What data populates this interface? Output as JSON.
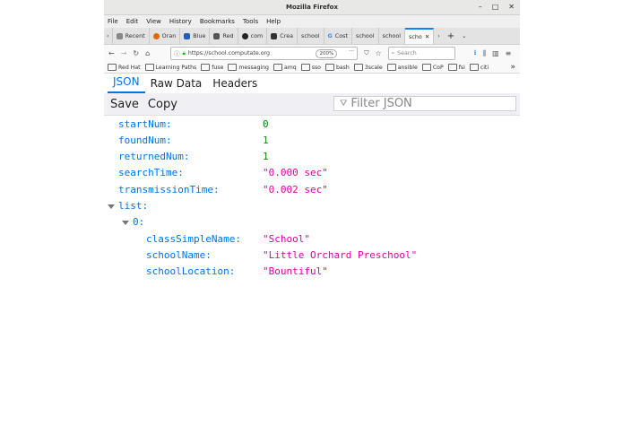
{
  "window": {
    "title": "Mozilla Firefox",
    "controls": [
      "–",
      "□",
      "✕"
    ]
  },
  "menu": [
    "File",
    "Edit",
    "View",
    "History",
    "Bookmarks",
    "Tools",
    "Help"
  ],
  "tabs": [
    {
      "label": "Recent",
      "icon": "page-icon",
      "color": "#888888"
    },
    {
      "label": "Oran",
      "icon": "orange-icon",
      "color": "#e06c00"
    },
    {
      "label": "Blue",
      "icon": "bl-icon",
      "color": "#1f5fbf"
    },
    {
      "label": "Red",
      "icon": "red-icon",
      "color": "#555555"
    },
    {
      "label": "com",
      "icon": "github-icon",
      "color": "#222222"
    },
    {
      "label": "Crea",
      "icon": "app-icon",
      "color": "#333333"
    },
    {
      "label": "school",
      "icon": "page-icon",
      "color": "#aaaaaa"
    },
    {
      "label": "Cost",
      "icon": "google-icon",
      "color": "#4285f4"
    },
    {
      "label": "school",
      "icon": "page-icon",
      "color": "#aaaaaa"
    },
    {
      "label": "school",
      "icon": "page-icon",
      "color": "#aaaaaa"
    },
    {
      "label": "scho",
      "icon": "page-icon",
      "color": "#aaaaaa",
      "active": true
    }
  ],
  "nav": {
    "url": "https://school.computate.org",
    "zoom": "200%",
    "search_placeholder": "Search"
  },
  "bookmarks": [
    "Red Hat",
    "Learning Paths",
    "fuse",
    "messaging",
    "amq",
    "sso",
    "bash",
    "3scale",
    "ansible",
    "CoP",
    "fsi",
    "citi"
  ],
  "viewer": {
    "tabs": [
      "JSON",
      "Raw Data",
      "Headers"
    ],
    "save_label": "Save",
    "copy_label": "Copy",
    "filter_placeholder": "Filter JSON"
  },
  "json": {
    "startNum": {
      "key": "startNum:",
      "value": "0"
    },
    "foundNum": {
      "key": "foundNum:",
      "value": "1"
    },
    "returnedNum": {
      "key": "returnedNum:",
      "value": "1"
    },
    "searchTime": {
      "key": "searchTime:",
      "value": "\"0.000 sec\""
    },
    "transmissionTime": {
      "key": "transmissionTime:",
      "value": "\"0.002 sec\""
    },
    "list": {
      "key": "list:"
    },
    "item0": {
      "key": "0:"
    },
    "classSimpleName": {
      "key": "classSimpleName:",
      "value": "\"School\""
    },
    "schoolName": {
      "key": "schoolName:",
      "value": "\"Little Orchard Preschool\""
    },
    "schoolLocation": {
      "key": "schoolLocation:",
      "value": "\"Bountiful\""
    }
  }
}
